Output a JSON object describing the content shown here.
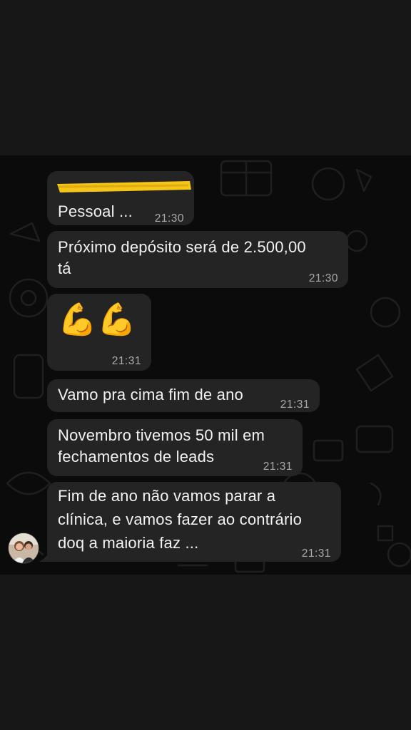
{
  "messages": [
    {
      "text": "Pessoal ...",
      "time": "21:30"
    },
    {
      "text_line1": "Próximo depósito será de 2.500,00",
      "text_line2": "tá",
      "time": "21:30"
    },
    {
      "emoji": "💪💪",
      "emoji_names": [
        "flexed-biceps-emoji",
        "flexed-biceps-emoji"
      ],
      "time": "21:31"
    },
    {
      "text": "Vamo pra cima fim de ano",
      "time": "21:31"
    },
    {
      "text_line1": "Novembro tivemos 50 mil em",
      "text_line2": "fechamentos de leads",
      "time": "21:31"
    },
    {
      "text_line1": "Fim de ano não vamos parar a",
      "text_line2": "clínica, e vamos fazer ao contrário",
      "text_line3": "doq a maioria faz ...",
      "time": "21:31"
    }
  ],
  "colors": {
    "bubble": "#242424",
    "chat_background": "#0b0b0b",
    "outer_background": "#171717",
    "highlight": "#f5c518",
    "timestamp": "#a9a9a9"
  },
  "icons": {
    "avatar": "sender-avatar"
  }
}
